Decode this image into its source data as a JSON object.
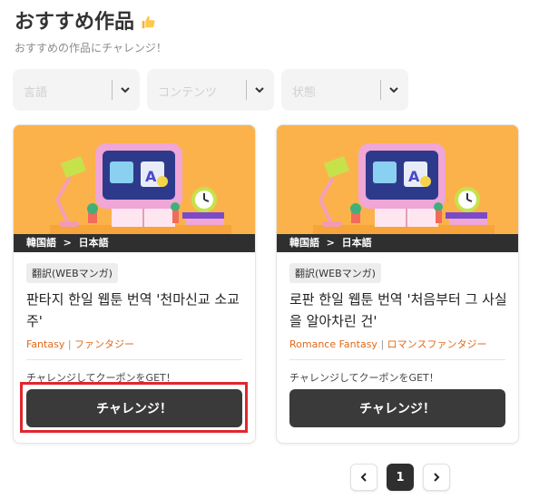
{
  "page": {
    "title": "おすすめ作品",
    "subtitle": "おすすめの作品にチャレンジ！"
  },
  "filters": [
    {
      "placeholder": "言語"
    },
    {
      "placeholder": "コンテンツ"
    },
    {
      "placeholder": "状態"
    }
  ],
  "cards": [
    {
      "lang_from": "韓国語",
      "lang_to": "日本語",
      "tag": "翻訳(WEBマンガ)",
      "title": "판타지 한일 웹툰 번역 '천마신교 소교주'",
      "genre_en": "Fantasy",
      "genre_jp": "ファンタジー",
      "cta_text": "チャレンジしてクーポンをGET！",
      "button": "チャレンジ！"
    },
    {
      "lang_from": "韓国語",
      "lang_to": "日本語",
      "tag": "翻訳(WEBマンガ)",
      "title": "로판 한일 웹툰 번역 '처음부터 그 사실을 알아차린 건'",
      "genre_en": "Romance Fantasy",
      "genre_jp": "ロマンスファンタジー",
      "cta_text": "チャレンジしてクーポンをGET！",
      "button": "チャレンジ！"
    }
  ],
  "pagination": {
    "current": "1"
  },
  "colors": {
    "accent_orange": "#e06a1b",
    "highlight_red": "#e0262e",
    "banner": "#fcb24b",
    "button": "#3a3a3a"
  }
}
